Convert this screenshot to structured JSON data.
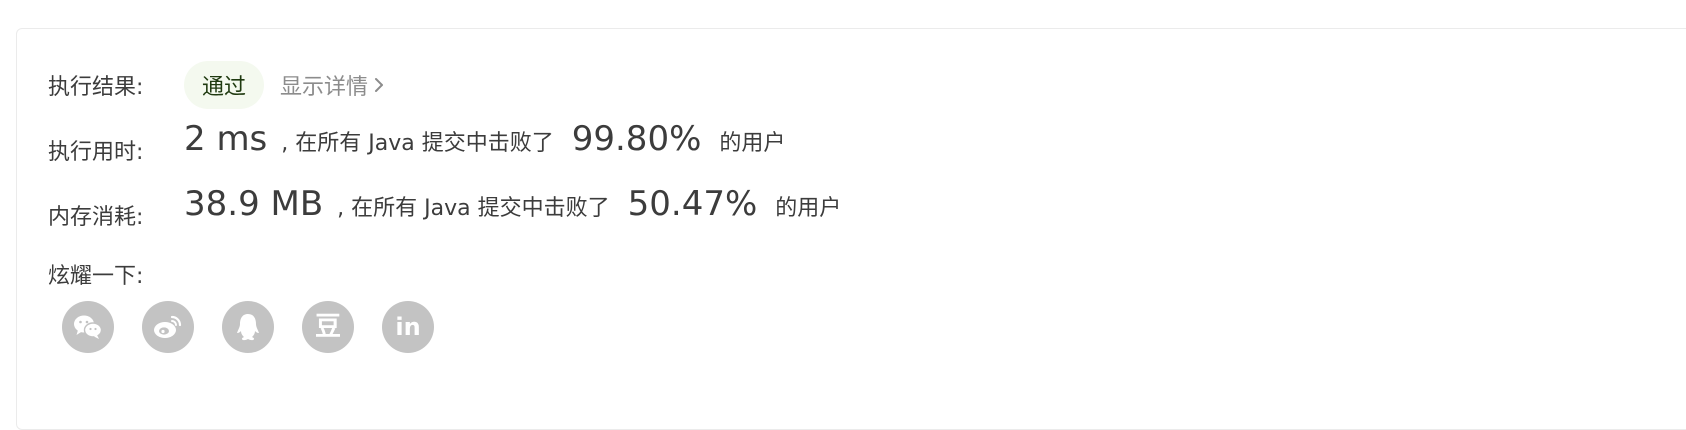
{
  "result": {
    "label": "执行结果:",
    "status": "通过",
    "details_link": "显示详情"
  },
  "runtime": {
    "label": "执行用时:",
    "value": "2 ms",
    "mid_text": ", 在所有 Java 提交中击败了",
    "percent": "99.80%",
    "suffix": "的用户"
  },
  "memory": {
    "label": "内存消耗:",
    "value": "38.9 MB",
    "mid_text": ", 在所有 Java 提交中击败了",
    "percent": "50.47%",
    "suffix": "的用户"
  },
  "share": {
    "label": "炫耀一下:",
    "buttons": [
      {
        "icon": "wechat-icon"
      },
      {
        "icon": "weibo-icon"
      },
      {
        "icon": "qq-icon"
      },
      {
        "icon": "douban-icon",
        "text": "豆"
      },
      {
        "icon": "linkedin-icon",
        "text": "in"
      }
    ]
  },
  "colors": {
    "text": "#3c3c3c",
    "muted": "#8c8c8c",
    "pass_bg": "#f4f9ef",
    "pass_text": "#1f3a10",
    "share_bg": "#c3c3c3"
  }
}
